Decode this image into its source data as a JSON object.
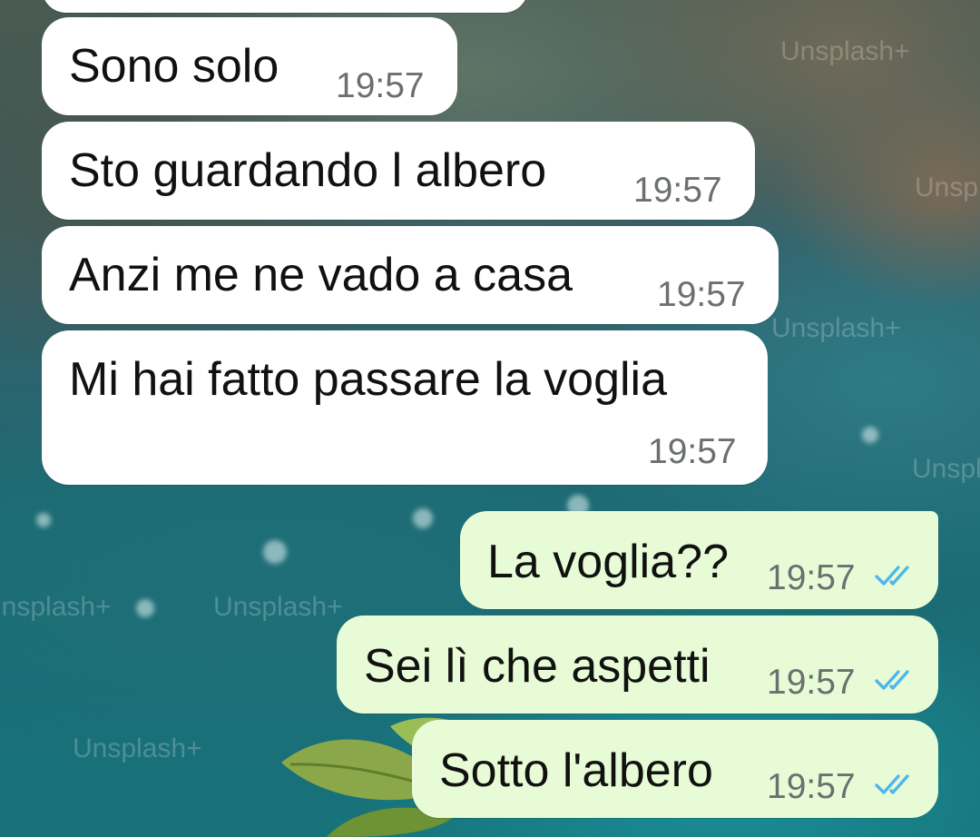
{
  "chat": {
    "messages": [
      {
        "direction": "incoming",
        "text": "Sono solo",
        "time": "19:57"
      },
      {
        "direction": "incoming",
        "text": "Sto guardando l albero",
        "time": "19:57"
      },
      {
        "direction": "incoming",
        "text": "Anzi me ne vado a casa",
        "time": "19:57"
      },
      {
        "direction": "incoming",
        "text": "Mi hai fatto passare la voglia",
        "time": "19:57"
      },
      {
        "direction": "outgoing",
        "text": "La voglia??",
        "time": "19:57",
        "status": "read"
      },
      {
        "direction": "outgoing",
        "text": "Sei lì che aspetti",
        "time": "19:57",
        "status": "read"
      },
      {
        "direction": "outgoing",
        "text": "Sotto l'albero",
        "time": "19:57",
        "status": "read"
      }
    ]
  },
  "background": {
    "watermark": "Unsplash+"
  },
  "colors": {
    "incoming_bubble": "#ffffff",
    "outgoing_bubble": "#e7fcd6",
    "read_check": "#4fb6ec",
    "timestamp": "#6b6f70"
  },
  "icons": {
    "read_receipt": "double-check-icon"
  }
}
